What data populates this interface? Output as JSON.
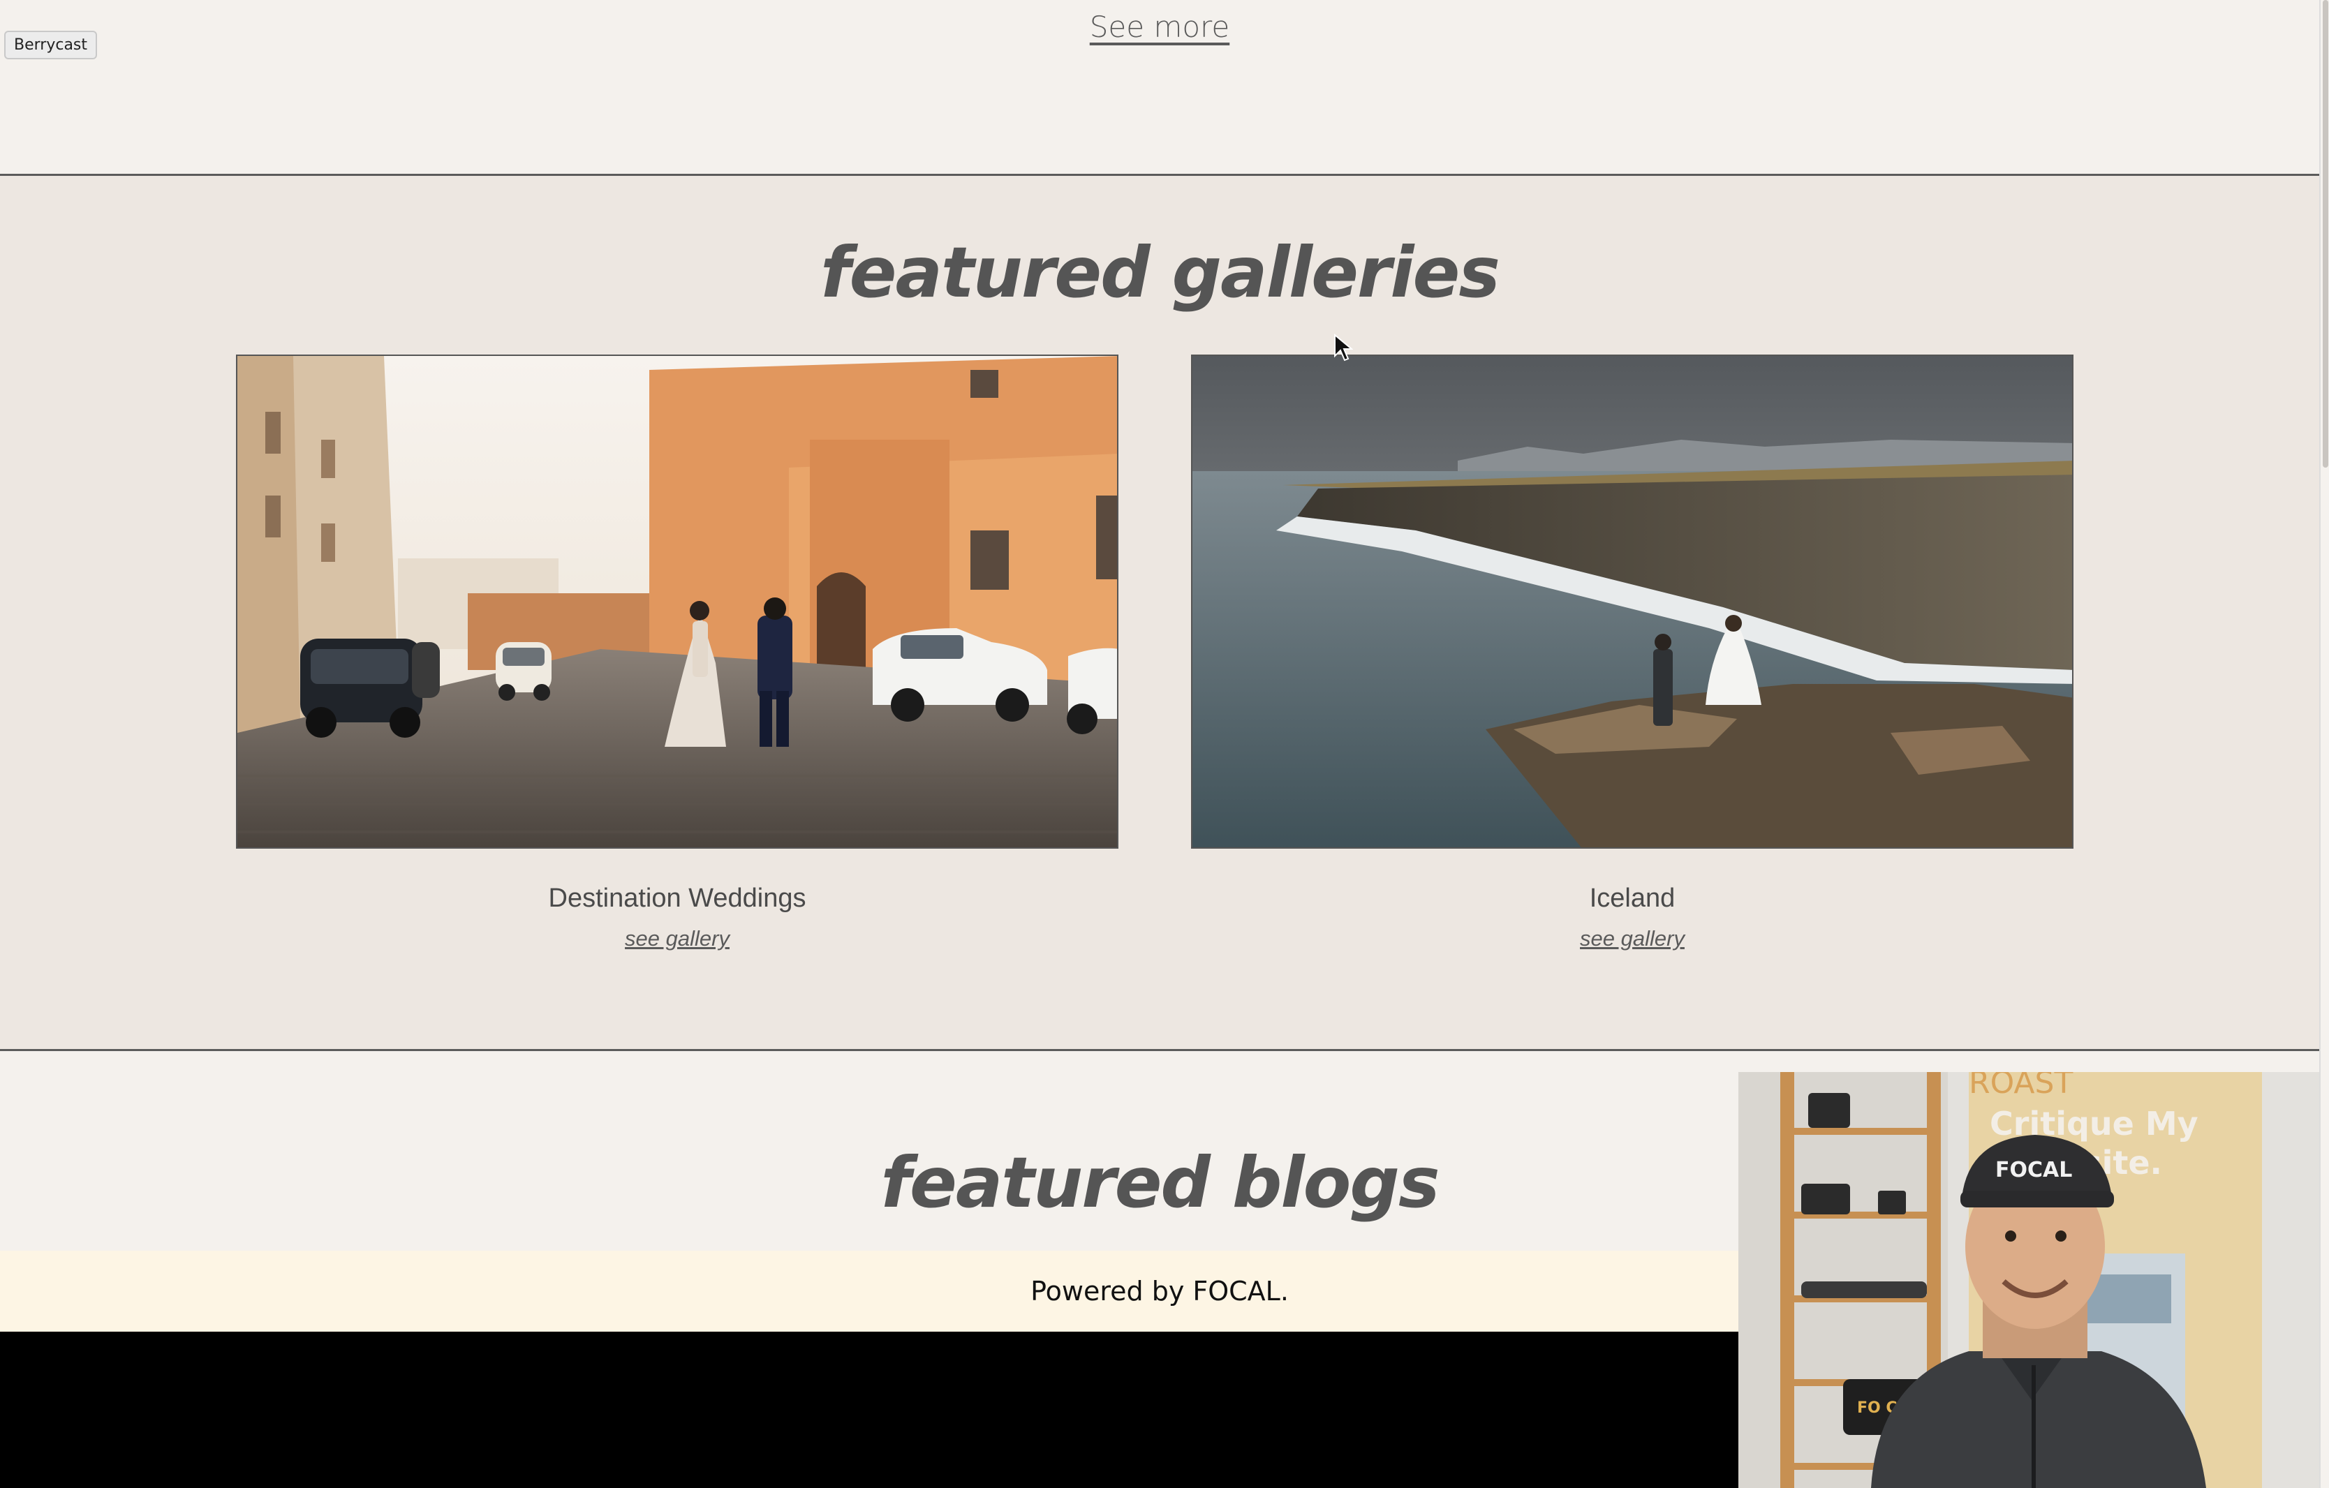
{
  "overlay": {
    "label": "Berrycast"
  },
  "top_section": {
    "see_more": "See more"
  },
  "galleries": {
    "heading": "featured galleries",
    "items": [
      {
        "title": "Destination Weddings",
        "link": "see gallery",
        "image": "rome-street-couple-photo"
      },
      {
        "title": "Iceland",
        "link": "see gallery",
        "image": "iceland-cliff-couple-photo"
      }
    ]
  },
  "blogs": {
    "heading": "featured blogs"
  },
  "footer": {
    "powered": "Powered by FOCAL."
  },
  "webcam": {
    "cap_text": "FOCAL",
    "poster_top": "ROAST",
    "poster_line1": "Critique My",
    "poster_line2": "Website.",
    "bag_text": "FO CAL"
  }
}
